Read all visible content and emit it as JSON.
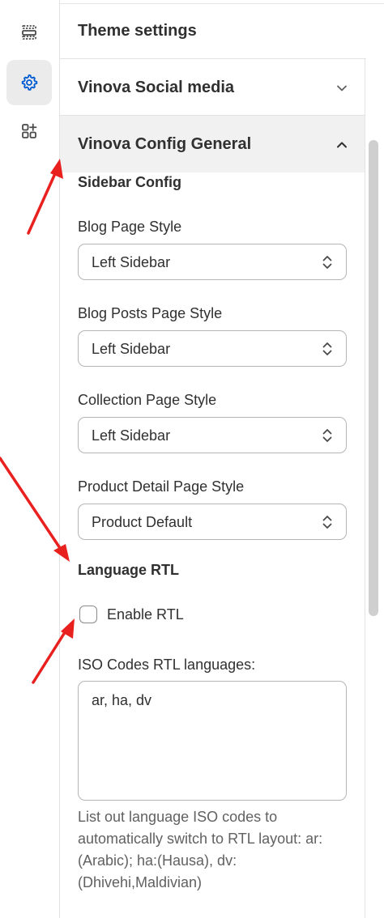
{
  "rail": {
    "items": [
      {
        "icon": "sections-icon",
        "active": false
      },
      {
        "icon": "gear-icon",
        "active": true
      },
      {
        "icon": "apps-icon",
        "active": false
      }
    ]
  },
  "header": {
    "title": "Theme settings"
  },
  "sections": [
    {
      "title": "Vinova Social media",
      "expanded": false
    },
    {
      "title": "Vinova Config General",
      "expanded": true
    }
  ],
  "config": {
    "sidebar_heading": "Sidebar Config",
    "fields": [
      {
        "label": "Blog Page Style",
        "value": "Left Sidebar"
      },
      {
        "label": "Blog Posts Page Style",
        "value": "Left Sidebar"
      },
      {
        "label": "Collection Page Style",
        "value": "Left Sidebar"
      },
      {
        "label": "Product Detail Page Style",
        "value": "Product Default"
      }
    ],
    "rtl_heading": "Language RTL",
    "enable_rtl_label": "Enable RTL",
    "enable_rtl_checked": false,
    "iso_label": "ISO Codes RTL languages:",
    "iso_value": "ar, ha, dv",
    "help_text": "List out language ISO codes to automatically switch to RTL layout: ar:(Arabic); ha:(Hausa), dv:(Dhivehi,Maldivian)"
  },
  "colors": {
    "accent": "#005bd3",
    "annotation": "#e8201e",
    "open_section_bg": "#f1f1f1"
  }
}
